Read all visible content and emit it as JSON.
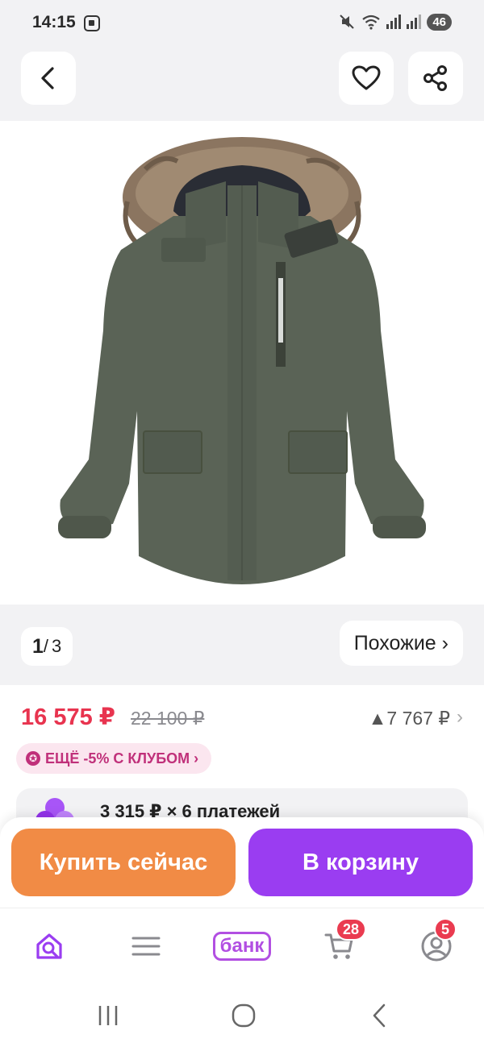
{
  "status_bar": {
    "time": "14:15",
    "battery": "46"
  },
  "header": {
    "back_icon": "chevron-left-icon",
    "favorite_icon": "heart-icon",
    "share_icon": "share-icon"
  },
  "product": {
    "image_icon": "parka-jacket-image",
    "image_color": "#5a6356",
    "fur_color": "#8b7560"
  },
  "gallery": {
    "current": "1",
    "separator": "/",
    "total": "3",
    "similar_label": "Похожие ›"
  },
  "price": {
    "current": "16 575 ₽",
    "old": "22 100 ₽",
    "stat": "▲7 767 ₽",
    "chevron": "›",
    "accent_color": "#e8344f"
  },
  "club_offer": {
    "label": "ЕЩЁ -5% С КЛУБОМ ›",
    "icon": "star-badge-icon"
  },
  "installments": {
    "text": "3 315 ₽ × 6 платежей",
    "icon": "split-clover-icon"
  },
  "actions": {
    "buy_now": "Купить сейчас",
    "add_to_cart": "В корзину",
    "buy_color": "#f18b45",
    "cart_color": "#9a3df1"
  },
  "bottom_nav": {
    "home_icon": "home-search-icon",
    "catalog_icon": "menu-lines-icon",
    "bank_label": "банк",
    "cart_icon": "cart-icon",
    "cart_badge": "28",
    "profile_icon": "profile-icon",
    "profile_badge": "5"
  },
  "system_nav": {
    "recents_icon": "recents-icon",
    "home_icon": "home-circle-icon",
    "back_icon": "system-back-icon"
  }
}
